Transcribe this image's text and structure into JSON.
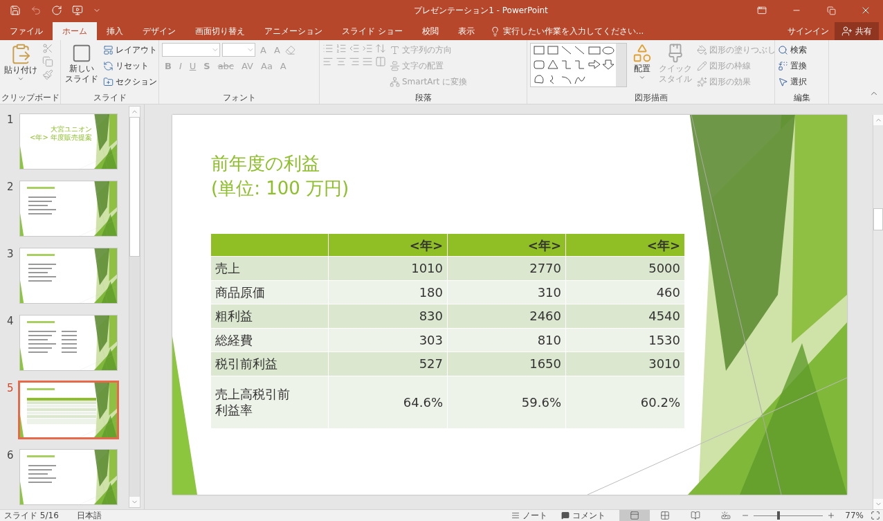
{
  "window": {
    "title": "プレゼンテーション1 - PowerPoint"
  },
  "tabs": [
    {
      "label": "ファイル",
      "selected": false
    },
    {
      "label": "ホーム",
      "selected": true
    },
    {
      "label": "挿入",
      "selected": false
    },
    {
      "label": "デザイン",
      "selected": false
    },
    {
      "label": "画面切り替え",
      "selected": false
    },
    {
      "label": "アニメーション",
      "selected": false
    },
    {
      "label": "スライド ショー",
      "selected": false
    },
    {
      "label": "校閲",
      "selected": false
    },
    {
      "label": "表示",
      "selected": false
    }
  ],
  "tell_me": {
    "placeholder": "実行したい作業を入力してください..."
  },
  "account": {
    "sign_in": "サインイン",
    "share": "共有"
  },
  "ribbon": {
    "clipboard": {
      "label": "クリップボード",
      "paste": "貼り付け"
    },
    "slides": {
      "label": "スライド",
      "new_slide": [
        "新しい",
        "スライド"
      ],
      "items": [
        "レイアウト",
        "リセット",
        "セクション"
      ]
    },
    "font": {
      "label": "フォント",
      "disabled": true,
      "size_buttons": [
        "A",
        "A"
      ],
      "buttons": [
        "B",
        "I",
        "U",
        "S",
        "abc",
        "AV",
        "Aa",
        "A"
      ]
    },
    "paragraph": {
      "label": "段落",
      "items": [
        {
          "label": "文字列の方向",
          "disabled": true
        },
        {
          "label": "文字の配置",
          "disabled": true
        },
        {
          "label": "SmartArt に変換",
          "disabled": true
        }
      ]
    },
    "drawing": {
      "label": "図形描画",
      "arrange": "配置",
      "quick_style": {
        "lines": [
          "クイック",
          "スタイル"
        ],
        "disabled": true
      },
      "items": [
        {
          "label": "図形の塗りつぶし",
          "disabled": true
        },
        {
          "label": "図形の枠線",
          "disabled": true
        },
        {
          "label": "図形の効果",
          "disabled": true
        }
      ]
    },
    "editing": {
      "label": "編集",
      "items": [
        {
          "label": "検索",
          "disabled": false
        },
        {
          "label": "置換",
          "disabled": false
        },
        {
          "label": "選択",
          "disabled": false
        }
      ]
    }
  },
  "slides_panel": [
    {
      "number": "1",
      "selected": false,
      "title": [
        "大宮ユニオン",
        "<年> 年度販売提案"
      ],
      "kind": "title"
    },
    {
      "number": "2",
      "selected": false,
      "kind": "bullets"
    },
    {
      "number": "3",
      "selected": false,
      "kind": "bullets"
    },
    {
      "number": "4",
      "selected": false,
      "kind": "columns"
    },
    {
      "number": "5",
      "selected": true,
      "kind": "table"
    },
    {
      "number": "6",
      "selected": false,
      "kind": "bullets"
    }
  ],
  "slide": {
    "title": [
      "前年度の利益",
      "(単位: 100 万円)"
    ],
    "table": {
      "columns": [
        "<年>",
        "<年>",
        "<年>"
      ],
      "rows": [
        {
          "label": [
            "売上"
          ],
          "values": [
            "1010",
            "2770",
            "5000"
          ]
        },
        {
          "label": [
            "商品原価"
          ],
          "values": [
            "180",
            "310",
            "460"
          ]
        },
        {
          "label": [
            "粗利益"
          ],
          "values": [
            "830",
            "2460",
            "4540"
          ]
        },
        {
          "label": [
            "総経費"
          ],
          "values": [
            "303",
            "810",
            "1530"
          ]
        },
        {
          "label": [
            "税引前利益"
          ],
          "values": [
            "527",
            "1650",
            "3010"
          ]
        },
        {
          "label": [
            "売上高税引前",
            "利益率"
          ],
          "values": [
            "64.6%",
            "59.6%",
            "60.2%"
          ]
        }
      ]
    }
  },
  "status_bar": {
    "slide": "スライド 5/16",
    "language": "日本語",
    "notes": "ノート",
    "comments": "コメント",
    "views": [
      {
        "kind": "normal",
        "selected": true
      },
      {
        "kind": "sorter",
        "selected": false
      },
      {
        "kind": "reading",
        "selected": false
      },
      {
        "kind": "slideshow",
        "selected": false
      }
    ],
    "zoom": {
      "level": 0.35,
      "reading": "77%"
    }
  }
}
